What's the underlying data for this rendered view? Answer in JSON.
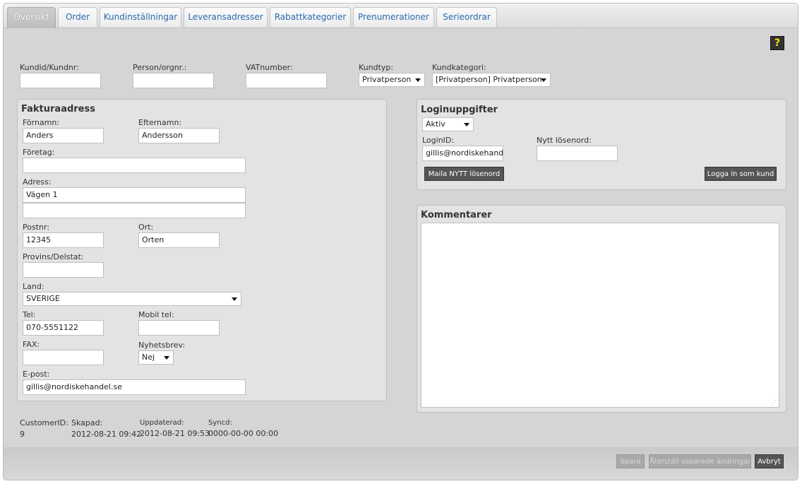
{
  "tabs": [
    "Översikt",
    "Order",
    "Kundinställningar",
    "Leveransadresser",
    "Rabattkategorier",
    "Prenumerationer",
    "Serieordrar"
  ],
  "help_label": "?",
  "top": {
    "kundid_label": "Kundid/Kundnr:",
    "person_label": "Person/orgnr.:",
    "vat_label": "VATnumber:",
    "kundtyp_label": "Kundtyp:",
    "kundtyp_value": "Privatperson",
    "kundkategori_label": "Kundkategori:",
    "kundkategori_value": "[Privatperson] Privatperson"
  },
  "faktura": {
    "title": "Fakturaadress",
    "fornamn_label": "Förnamn:",
    "fornamn_value": "Anders",
    "efternamn_label": "Efternamn:",
    "efternamn_value": "Andersson",
    "foretag_label": "Företag:",
    "adress_label": "Adress:",
    "adress1_value": "Vägen 1",
    "postnr_label": "Postnr:",
    "postnr_value": "12345",
    "ort_label": "Ort:",
    "ort_value": "Orten",
    "provins_label": "Provins/Delstat:",
    "land_label": "Land:",
    "land_value": "SVERIGE",
    "tel_label": "Tel:",
    "tel_value": "070-5551122",
    "mobil_label": "Mobil tel:",
    "fax_label": "FAX:",
    "nyhetsbrev_label": "Nyhetsbrev:",
    "nyhetsbrev_value": "Nej",
    "epost_label": "E-post:",
    "epost_value": "gillis@nordiskehandel.se"
  },
  "login": {
    "title": "Loginuppgifter",
    "status_value": "Aktiv",
    "loginid_label": "LoginID:",
    "loginid_value": "gillis@nordiskehandel.",
    "nytt_label": "Nytt lösenord:",
    "maila_button": "Maila NYTT lösenord",
    "logga_button": "Logga in som kund"
  },
  "kommentarer": {
    "title": "Kommentarer"
  },
  "meta": {
    "customerid_label": "CustomerID:",
    "customerid_value": "9",
    "skapad_label": "Skapad:",
    "skapad_value": "2012-08-21 09:42",
    "uppdaterad_label": "Uppdaterad:",
    "uppdaterad_value": "2012-08-21 09:53",
    "syncd_label": "Syncd:",
    "syncd_value": "0000-00-00 00:00"
  },
  "footer": {
    "spara": "Spara",
    "aterstall": "Återställ osparade ändringar",
    "avbryt": "Avbryt"
  },
  "colors": {
    "tab_text": "#2a6cb0",
    "help_bg": "#333333",
    "help_fg": "#f7e400",
    "button_bg": "#555555"
  }
}
